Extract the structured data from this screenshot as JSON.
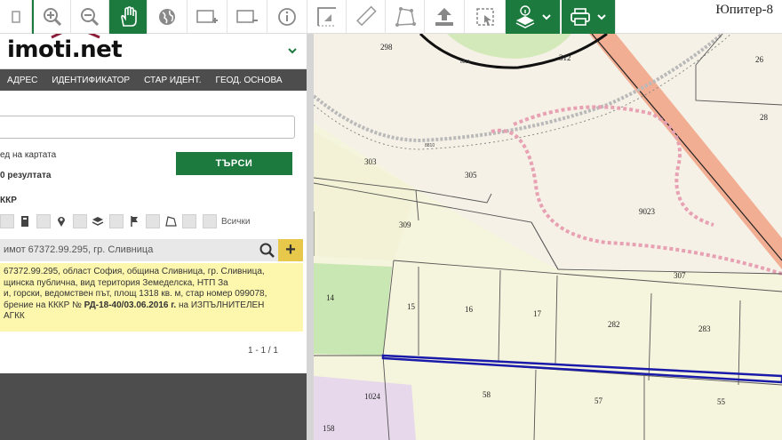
{
  "toolbar": {
    "watermark": "Юпитер-8",
    "buttons": [
      {
        "name": "zoom-in-icon",
        "active": false
      },
      {
        "name": "zoom-out-icon",
        "active": false
      },
      {
        "name": "pan-hand-icon",
        "active": true
      },
      {
        "name": "globe-icon",
        "active": false
      },
      {
        "name": "add-window-icon",
        "active": false
      },
      {
        "name": "remove-window-icon",
        "active": false
      },
      {
        "name": "info-icon",
        "active": false
      },
      {
        "name": "measure-coords-icon",
        "active": false
      },
      {
        "name": "ruler-icon",
        "active": false
      },
      {
        "name": "area-measure-icon",
        "active": false
      },
      {
        "name": "upload-icon",
        "active": false
      },
      {
        "name": "select-area-icon",
        "active": false
      },
      {
        "name": "layers-info-icon",
        "active": true
      },
      {
        "name": "print-icon",
        "active": true
      }
    ]
  },
  "panel": {
    "logo": "imoti.net",
    "tabs": [
      "АДРЕС",
      "ИДЕНТИФИКАТОР",
      "СТАР ИДЕНТ.",
      "ГЕОД. ОСНОВА"
    ],
    "search_value": "",
    "map_view_label": "ед на картата",
    "results_count_label": "0 резултата",
    "search_button": "ТЪРСИ",
    "kkr_label": "ККР",
    "all_label": "Всички",
    "result_title": "имот 67372.99.295, гр. Сливница",
    "result_text_1": "67372.99.295, област София, община Сливница, гр. Сливница,",
    "result_text_2": "щинска публична, вид територия Земеделска, НТП За",
    "result_text_3": "и, горски, ведомствен път, площ 1318 кв. м, стар номер 099078,",
    "result_text_4a": "брение на КККР №",
    "result_text_4b": "РД-18-40/03.06.2016 г.",
    "result_text_4c": "на ИЗПЪЛНИТЕЛЕН",
    "result_text_5": "АГКК",
    "pager": "1 - 1 / 1"
  },
  "map": {
    "labels": [
      "298",
      "312",
      "26",
      "28",
      "303",
      "305",
      "9023",
      "309",
      "307",
      "14",
      "15",
      "16",
      "17",
      "282",
      "283",
      "1024",
      "58",
      "57",
      "55",
      "158"
    ],
    "road_text_1": "8811",
    "road_text_2": "8810"
  },
  "colors": {
    "accent_green": "#1c7a3e",
    "panel_dark": "#4d4d4d",
    "result_highlight": "#fdf7ae",
    "selected_parcel": "#1a1aaa"
  }
}
